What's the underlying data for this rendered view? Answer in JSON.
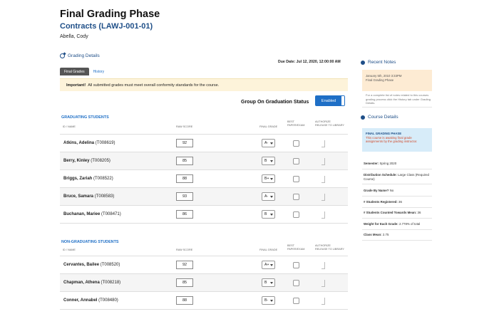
{
  "page": {
    "title": "Final Grading Phase",
    "course": "Contracts (LAWJ-001-01)",
    "student": "Abella, Cody"
  },
  "grading": {
    "heading": "Grading Details",
    "due": "Due Date: Jul 12, 2020, 12:00:00 AM",
    "tabs": [
      "Final Grades",
      "History"
    ],
    "important_label": "Important!",
    "important_text": "All submitted grades must meet overall conformity standards for the course.",
    "group_label": "Group On Graduation Status",
    "toggle_label": "Enabled"
  },
  "columns": {
    "id_name": "ID / NAME",
    "raw_score": "RAW SCORE",
    "final_grade": "FINAL GRADE",
    "best_paper_1": "BEST",
    "best_paper_2": "PAPER/EXAM",
    "authorize_1": "AUTHORIZE",
    "authorize_2": "RELEASE TO LIBRARY"
  },
  "graduating": {
    "title": "GRADUATING STUDENTS",
    "rows": [
      {
        "last": "Atkins, Adelina",
        "id": "(T008619)",
        "score": "92",
        "grade": "A-"
      },
      {
        "last": "Berry, Kinley",
        "id": "(T008205)",
        "score": "85",
        "grade": "B"
      },
      {
        "last": "Briggs, Zariah",
        "id": "(T008522)",
        "score": "88",
        "grade": "B+"
      },
      {
        "last": "Bruce, Samara",
        "id": "(T008583)",
        "score": "93",
        "grade": "A-"
      },
      {
        "last": "Buchanan, Mariee",
        "id": "(T008471)",
        "score": "86",
        "grade": "B"
      }
    ]
  },
  "non_graduating": {
    "title": "NON-GRADUATING STUDENTS",
    "rows": [
      {
        "last": "Cervantes, Bailee",
        "id": "(T008520)",
        "score": "92",
        "grade": "A+"
      },
      {
        "last": "Chapman, Athena",
        "id": "(T008218)",
        "score": "85",
        "grade": "B"
      },
      {
        "last": "Conner, Annabel",
        "id": "(T008480)",
        "score": "88",
        "grade": "B-"
      }
    ]
  },
  "sidebar": {
    "recent_notes": "Recent Notes",
    "note_date": "January 5th, 2010 3:33PM",
    "note_text": "Final Grading Phase",
    "note_hint": "For a complete list of notes related to this courses grading process click the History tab under Grading Details.",
    "course_details": "Course Details",
    "phase_title": "FINAL GRADING PHASE",
    "phase_desc": "This course is awaiting final grade assignments by the grading instructor.",
    "details": [
      {
        "label": "Semester:",
        "value": " Spring 2020"
      },
      {
        "label": "Distribution Schedule:",
        "value": " Large Class (Required Course)"
      },
      {
        "label": "Grade By Name?",
        "value": " No"
      },
      {
        "label": "# Students Registered:",
        "value": " 36"
      },
      {
        "label": "# Students Counted Towards Mean:",
        "value": " 36"
      },
      {
        "label": "Weight for Each Grade:",
        "value": " 2.778% of total"
      },
      {
        "label": "Class Mean:",
        "value": " 2.75"
      }
    ]
  },
  "colors": {
    "accent": "#1f6fc6",
    "title_blue": "#1f4f88",
    "warning_bg": "#fdf3da",
    "note_bg": "#fdebd3",
    "phase_bg": "#d7ecf9",
    "phase_text": "#d04a2a"
  }
}
